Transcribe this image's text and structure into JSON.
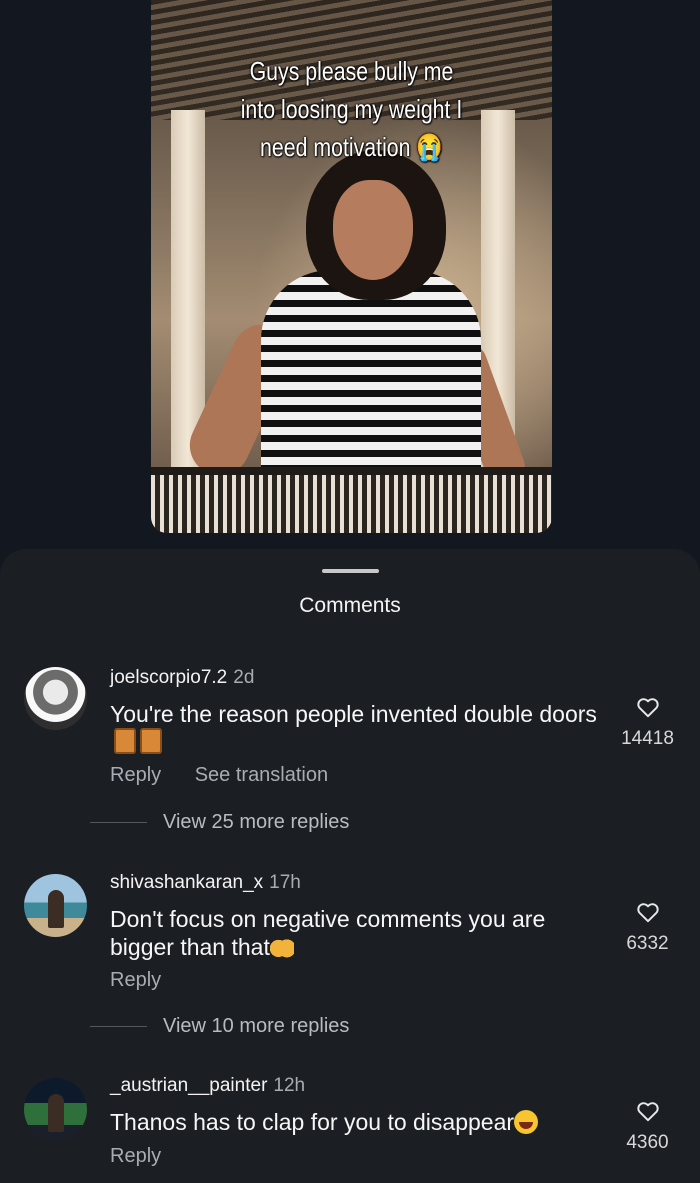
{
  "post": {
    "caption": "Guys please bully me\ninto loosing my weight I\nneed motivation 😭"
  },
  "sheet": {
    "title": "Comments"
  },
  "comments": [
    {
      "username": "joelscorpio7.2",
      "time": "2d",
      "text": "You're the reason people invented double doors",
      "emoji": "door-emoji",
      "reply_label": "Reply",
      "translate_label": "See translation",
      "likes": "14418",
      "view_replies": "View 25 more replies"
    },
    {
      "username": "shivashankaran_x",
      "time": "17h",
      "text": "Don't focus on negative comments you are bigger than that",
      "emoji": "raised-hands-emoji",
      "reply_label": "Reply",
      "likes": "6332",
      "view_replies": "View 10 more replies"
    },
    {
      "username": "_austrian__painter",
      "time": "12h",
      "text": "Thanos has to clap for you to disappear",
      "emoji": "tears-of-joy-emoji",
      "reply_label": "Reply",
      "likes": "4360"
    }
  ],
  "colors": {
    "background": "#13171f",
    "sheet": "#1b1f24",
    "secondary_text": "#a9adb3"
  }
}
